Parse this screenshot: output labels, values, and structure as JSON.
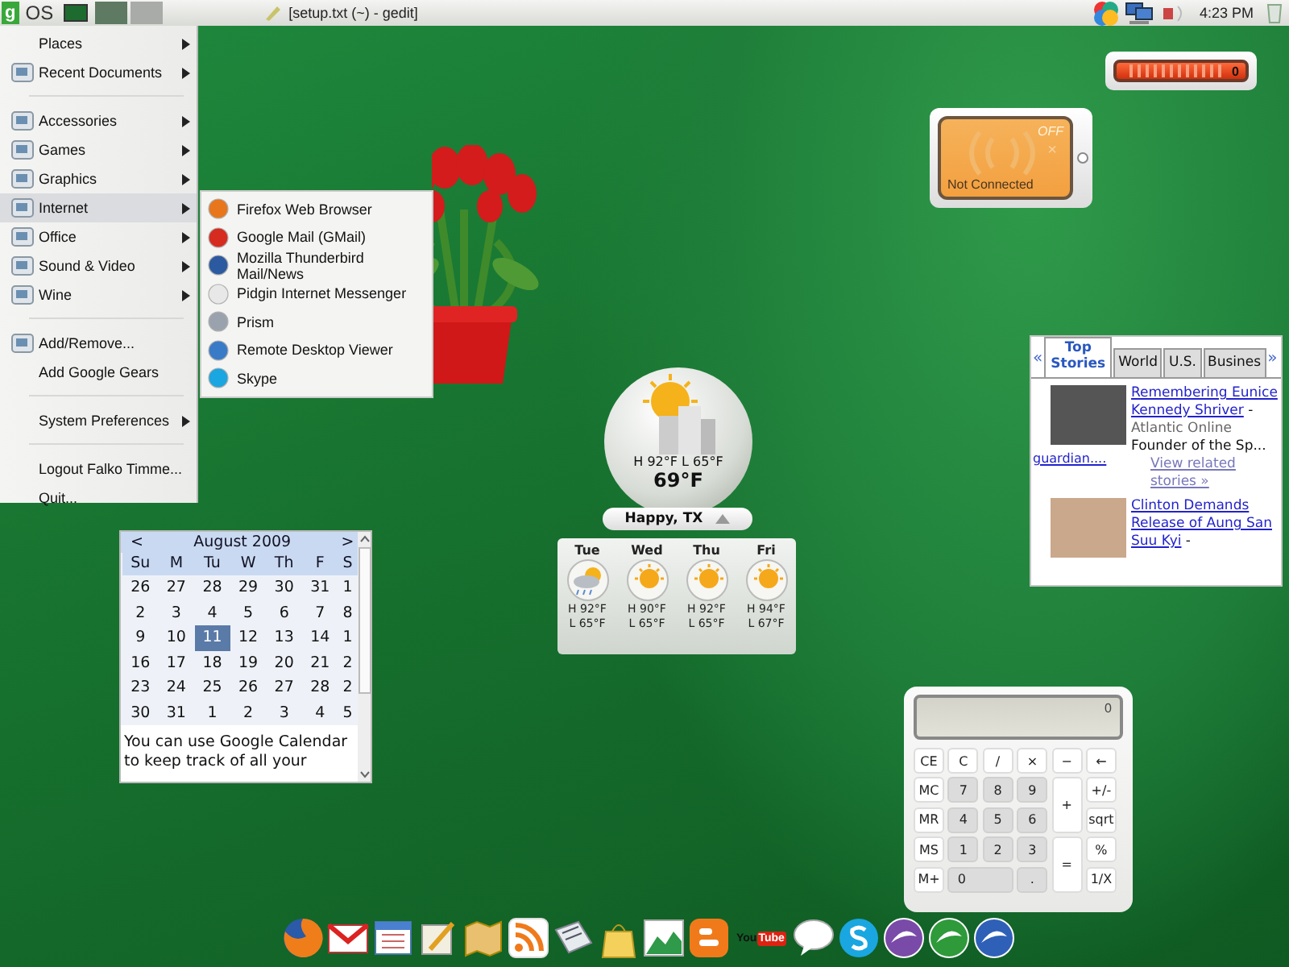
{
  "top_panel": {
    "logo_mark": "g",
    "logo_text": "OS",
    "task_title": "[setup.txt (~) - gedit]",
    "clock": "4:23 PM"
  },
  "menu": {
    "sections": [
      {
        "items": [
          {
            "label": "Places",
            "icon": false,
            "submenu": true,
            "selected": false
          },
          {
            "label": "Recent Documents",
            "icon": true,
            "submenu": true,
            "selected": false
          }
        ]
      },
      {
        "items": [
          {
            "label": "Accessories",
            "icon": true,
            "submenu": true,
            "selected": false
          },
          {
            "label": "Games",
            "icon": true,
            "submenu": true,
            "selected": false
          },
          {
            "label": "Graphics",
            "icon": true,
            "submenu": true,
            "selected": false
          },
          {
            "label": "Internet",
            "icon": true,
            "submenu": true,
            "selected": true
          },
          {
            "label": "Office",
            "icon": true,
            "submenu": true,
            "selected": false
          },
          {
            "label": "Sound & Video",
            "icon": true,
            "submenu": true,
            "selected": false
          },
          {
            "label": "Wine",
            "icon": true,
            "submenu": true,
            "selected": false
          }
        ]
      },
      {
        "items": [
          {
            "label": "Add/Remove...",
            "icon": true,
            "submenu": false,
            "selected": false
          },
          {
            "label": "Add Google Gears",
            "icon": false,
            "submenu": false,
            "selected": false
          }
        ]
      },
      {
        "items": [
          {
            "label": "System Preferences",
            "icon": false,
            "submenu": true,
            "selected": false
          }
        ]
      },
      {
        "items": [
          {
            "label": "Logout Falko Timme...",
            "icon": false,
            "submenu": false,
            "selected": false
          },
          {
            "label": "Quit...",
            "icon": false,
            "submenu": false,
            "selected": false
          }
        ]
      }
    ]
  },
  "submenu": {
    "items": [
      {
        "label": "Firefox Web Browser",
        "color": "#e8761c"
      },
      {
        "label": "Google Mail (GMail)",
        "color": "#d62b1f"
      },
      {
        "label": "Mozilla Thunderbird Mail/News",
        "color": "#2c5aa0"
      },
      {
        "label": "Pidgin Internet Messenger",
        "color": "#e8e8e8"
      },
      {
        "label": "Prism",
        "color": "#9aa3ad"
      },
      {
        "label": "Remote Desktop Viewer",
        "color": "#3a7bc8"
      },
      {
        "label": "Skype",
        "color": "#1aa6e0"
      }
    ]
  },
  "battery_widget": {
    "reading": "0"
  },
  "wifi_widget": {
    "state": "OFF",
    "mark": "×",
    "status": "Not Connected"
  },
  "news": {
    "prev": "«",
    "next": "»",
    "tabs": [
      {
        "label": "Top Stories",
        "selected": true
      },
      {
        "label": "World",
        "selected": false
      },
      {
        "label": "U.S.",
        "selected": false
      },
      {
        "label": "Busines",
        "selected": false
      }
    ],
    "stories": [
      {
        "photo_link": "guardian....",
        "headline": "Remembering Eunice Kennedy Shriver",
        "dash": "-",
        "source": "Atlantic Online",
        "snippet": "Founder of the Sp...",
        "related": "View related stories »"
      },
      {
        "headline": "Clinton Demands Release of Aung San Suu Kyi",
        "dash": "-"
      }
    ]
  },
  "weather": {
    "hi_lo": "H 92°F L 65°F",
    "temperature": "69°F",
    "location": "Happy, TX",
    "forecast": [
      {
        "day": "Tue",
        "kind": "storm",
        "high": "H 92°F",
        "low": "L 65°F"
      },
      {
        "day": "Wed",
        "kind": "sunny",
        "high": "H 90°F",
        "low": "L 65°F"
      },
      {
        "day": "Thu",
        "kind": "sunny",
        "high": "H 92°F",
        "low": "L 65°F"
      },
      {
        "day": "Fri",
        "kind": "sunny",
        "high": "H 94°F",
        "low": "L 67°F"
      }
    ]
  },
  "calendar": {
    "prev": "<",
    "month": "August 2009",
    "next": ">",
    "weekdays": [
      "Su",
      "M",
      "Tu",
      "W",
      "Th",
      "F",
      "S"
    ],
    "weeks": [
      {
        "days": [
          {
            "label": "26",
            "selected": false
          },
          {
            "label": "27",
            "selected": false
          },
          {
            "label": "28",
            "selected": false
          },
          {
            "label": "29",
            "selected": false
          },
          {
            "label": "30",
            "selected": false
          },
          {
            "label": "31",
            "selected": false
          },
          {
            "label": "1",
            "selected": false
          }
        ]
      },
      {
        "days": [
          {
            "label": "2",
            "selected": false
          },
          {
            "label": "3",
            "selected": false
          },
          {
            "label": "4",
            "selected": false
          },
          {
            "label": "5",
            "selected": false
          },
          {
            "label": "6",
            "selected": false
          },
          {
            "label": "7",
            "selected": false
          },
          {
            "label": "8",
            "selected": false
          }
        ]
      },
      {
        "days": [
          {
            "label": "9",
            "selected": false
          },
          {
            "label": "10",
            "selected": false
          },
          {
            "label": "11",
            "selected": true
          },
          {
            "label": "12",
            "selected": false
          },
          {
            "label": "13",
            "selected": false
          },
          {
            "label": "14",
            "selected": false
          },
          {
            "label": "1",
            "selected": false
          }
        ]
      },
      {
        "days": [
          {
            "label": "16",
            "selected": false
          },
          {
            "label": "17",
            "selected": false
          },
          {
            "label": "18",
            "selected": false
          },
          {
            "label": "19",
            "selected": false
          },
          {
            "label": "20",
            "selected": false
          },
          {
            "label": "21",
            "selected": false
          },
          {
            "label": "2",
            "selected": false
          }
        ]
      },
      {
        "days": [
          {
            "label": "23",
            "selected": false
          },
          {
            "label": "24",
            "selected": false
          },
          {
            "label": "25",
            "selected": false
          },
          {
            "label": "26",
            "selected": false
          },
          {
            "label": "27",
            "selected": false
          },
          {
            "label": "28",
            "selected": false
          },
          {
            "label": "2",
            "selected": false
          }
        ]
      },
      {
        "days": [
          {
            "label": "30",
            "selected": false
          },
          {
            "label": "31",
            "selected": false
          },
          {
            "label": "1",
            "selected": false
          },
          {
            "label": "2",
            "selected": false
          },
          {
            "label": "3",
            "selected": false
          },
          {
            "label": "4",
            "selected": false
          },
          {
            "label": "5",
            "selected": false
          }
        ]
      }
    ],
    "note": "You can use Google Calendar to keep track of all your"
  },
  "calculator": {
    "display": "0",
    "keys": [
      {
        "label": "CE",
        "kind": "fn"
      },
      {
        "label": "C",
        "kind": "fn"
      },
      {
        "label": "/",
        "kind": "fn"
      },
      {
        "label": "×",
        "kind": "fn"
      },
      {
        "label": "−",
        "kind": "fn"
      },
      {
        "label": "←",
        "kind": "fn"
      },
      {
        "label": "MC",
        "kind": "fn"
      },
      {
        "label": "7",
        "kind": "digit"
      },
      {
        "label": "8",
        "kind": "digit"
      },
      {
        "label": "9",
        "kind": "digit"
      },
      {
        "label": "+",
        "kind": "tall"
      },
      {
        "label": "+/-",
        "kind": "fn"
      },
      {
        "label": "MR",
        "kind": "fn"
      },
      {
        "label": "4",
        "kind": "digit"
      },
      {
        "label": "5",
        "kind": "digit"
      },
      {
        "label": "6",
        "kind": "digit"
      },
      {
        "label": "sqrt",
        "kind": "fn"
      },
      {
        "label": "MS",
        "kind": "fn"
      },
      {
        "label": "1",
        "kind": "digit"
      },
      {
        "label": "2",
        "kind": "digit"
      },
      {
        "label": "3",
        "kind": "digit"
      },
      {
        "label": "=",
        "kind": "tall"
      },
      {
        "label": "%",
        "kind": "fn"
      },
      {
        "label": "M+",
        "kind": "fn"
      },
      {
        "label": "0",
        "kind": "wide"
      },
      {
        "label": ".",
        "kind": "digit"
      },
      {
        "label": "1/X",
        "kind": "fn"
      }
    ]
  },
  "dock": {
    "video_logo": [
      "You",
      "Tube"
    ]
  }
}
